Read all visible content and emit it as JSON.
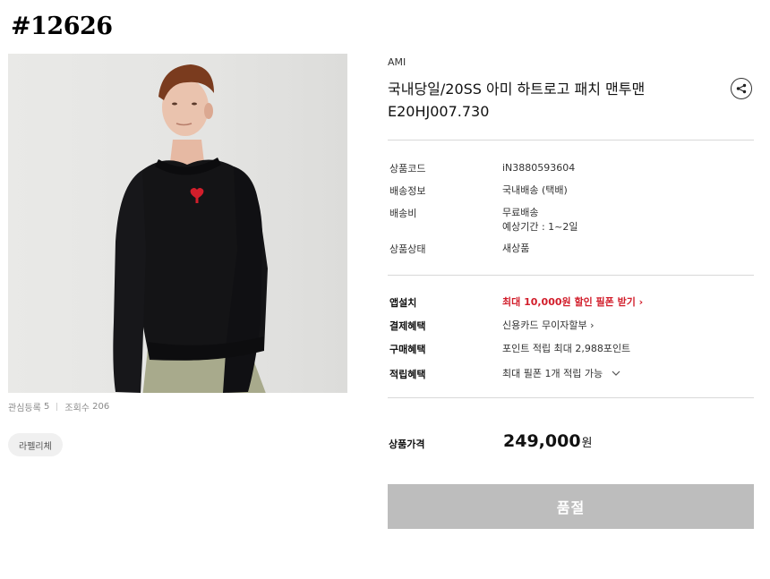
{
  "listing_no": "#12626",
  "product": {
    "brand": "AMI",
    "title_line1": "국내당일/20SS 아미 하트로고 패치 맨투맨",
    "title_line2": "E20HJ007.730"
  },
  "stats": {
    "likes_label": "관심등록",
    "likes": "5",
    "views_label": "조회수",
    "views": "206"
  },
  "tag": "라펠리체",
  "info": [
    {
      "label": "상품코드",
      "value": "iN3880593604"
    },
    {
      "label": "배송정보",
      "value": "국내배송 (택배)"
    },
    {
      "label": "배송비",
      "value": "무료배송",
      "value2": "예상기간 : 1~2일"
    },
    {
      "label": "상품상태",
      "value": "새상품"
    }
  ],
  "benefits": [
    {
      "label": "앱설치",
      "value": "최대 10,000원 할인 필폰 받기 ›"
    },
    {
      "label": "결제혜택",
      "value": "신용카드 무이자할부 ›"
    },
    {
      "label": "구매혜택",
      "value": "포인트 적립 최대 2,988포인트"
    },
    {
      "label": "적립혜택",
      "value": "최대 필폰 1개 적립 가능"
    }
  ],
  "price": {
    "label": "상품가격",
    "amount": "249,000",
    "unit": "원"
  },
  "buy_button": "품절",
  "colors": {
    "accent_red": "#d21e2b",
    "soldout_gray": "#bdbdbd"
  },
  "icons": {
    "share": "share-icon",
    "expand": "chevron-down-icon"
  }
}
